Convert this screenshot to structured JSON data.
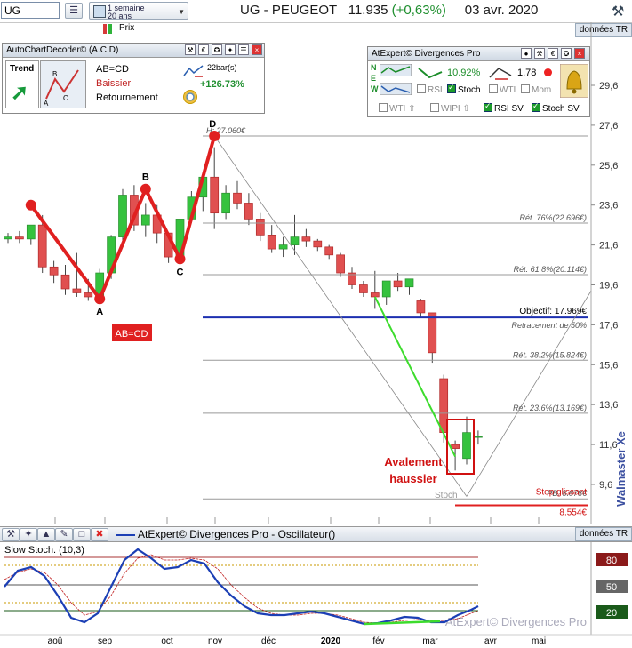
{
  "toolbar": {
    "ticker": "UG",
    "period_line1": "1 semaine",
    "period_line2": "20 ans",
    "price_label": "Prix",
    "title_symbol": "UG - PEUGEOT",
    "title_price": "11.935",
    "title_change": "(+0,63%)",
    "title_date": "03 avr. 2020",
    "data_button": "données TR"
  },
  "acd": {
    "header": "AutoChartDecoder© (A.C.D)",
    "trend_label": "Trend",
    "pattern": "AB=CD",
    "direction": "Baissier",
    "signal": "Retournement",
    "bars": "22bar(s)",
    "performance": "+126.73%"
  },
  "atexpert": {
    "header": "AtExpert© Divergences Pro",
    "pct": "10.92%",
    "ratio": "1.78",
    "rsi": "RSI",
    "stoch": "Stoch",
    "wti": "WTI",
    "mom": "Mom",
    "wti2": "WTI",
    "wipi": "WIPI",
    "rsi_sv": "RSI SV",
    "stoch_sv": "Stoch SV",
    "side_letters": [
      "N",
      "E",
      "W"
    ]
  },
  "oscillator": {
    "title": "AtExpert© Divergences Pro - Oscillateur()",
    "data_button": "données TR",
    "indicator": "Slow Stoch. (10,3)",
    "levels": [
      "80",
      "50",
      "20"
    ],
    "watermark": "AtExpert© Divergences Pro"
  },
  "side_text": "Walmaster Xe",
  "chart_data": {
    "type": "candlestick",
    "y_ticks": [
      29.6,
      27.6,
      25.6,
      23.6,
      21.6,
      19.6,
      17.6,
      15.6,
      13.6,
      11.6,
      9.6
    ],
    "y_range": [
      8.4,
      30.3
    ],
    "x_ticks": [
      "aoû",
      "sep",
      "oct",
      "nov",
      "déc",
      "2020",
      "fév",
      "mar",
      "avr",
      "mai"
    ],
    "candles": [
      {
        "o": 21.9,
        "h": 22.2,
        "l": 21.7,
        "c": 22.0
      },
      {
        "o": 22.0,
        "h": 22.3,
        "l": 21.7,
        "c": 21.9
      },
      {
        "o": 21.9,
        "h": 22.2,
        "l": 21.6,
        "c": 22.6
      },
      {
        "o": 22.6,
        "h": 23.1,
        "l": 20.2,
        "c": 20.5
      },
      {
        "o": 20.5,
        "h": 20.8,
        "l": 19.7,
        "c": 20.1
      },
      {
        "o": 20.1,
        "h": 20.6,
        "l": 19.1,
        "c": 19.4
      },
      {
        "o": 19.4,
        "h": 21.2,
        "l": 19.0,
        "c": 19.2
      },
      {
        "o": 19.2,
        "h": 19.9,
        "l": 18.8,
        "c": 19.0
      },
      {
        "o": 19.0,
        "h": 20.4,
        "l": 18.7,
        "c": 20.2
      },
      {
        "o": 20.2,
        "h": 22.1,
        "l": 19.9,
        "c": 22.0
      },
      {
        "o": 22.0,
        "h": 24.4,
        "l": 21.6,
        "c": 24.1
      },
      {
        "o": 24.1,
        "h": 24.6,
        "l": 22.3,
        "c": 22.6
      },
      {
        "o": 22.6,
        "h": 23.7,
        "l": 22.0,
        "c": 23.1
      },
      {
        "o": 23.1,
        "h": 23.6,
        "l": 21.7,
        "c": 22.2
      },
      {
        "o": 22.2,
        "h": 21.9,
        "l": 20.7,
        "c": 21.0
      },
      {
        "o": 21.0,
        "h": 23.3,
        "l": 20.9,
        "c": 22.9
      },
      {
        "o": 22.9,
        "h": 24.3,
        "l": 22.7,
        "c": 24.0
      },
      {
        "o": 24.0,
        "h": 25.0,
        "l": 23.3,
        "c": 25.0
      },
      {
        "o": 25.0,
        "h": 26.5,
        "l": 22.4,
        "c": 23.2
      },
      {
        "o": 23.2,
        "h": 24.6,
        "l": 22.9,
        "c": 24.2
      },
      {
        "o": 24.2,
        "h": 24.8,
        "l": 23.4,
        "c": 23.7
      },
      {
        "o": 23.7,
        "h": 24.2,
        "l": 22.6,
        "c": 22.9
      },
      {
        "o": 22.9,
        "h": 23.2,
        "l": 21.8,
        "c": 22.1
      },
      {
        "o": 22.1,
        "h": 22.6,
        "l": 21.2,
        "c": 21.4
      },
      {
        "o": 21.4,
        "h": 22.0,
        "l": 21.0,
        "c": 21.6
      },
      {
        "o": 21.6,
        "h": 23.1,
        "l": 21.1,
        "c": 22.0
      },
      {
        "o": 22.0,
        "h": 22.4,
        "l": 21.5,
        "c": 21.8
      },
      {
        "o": 21.8,
        "h": 21.9,
        "l": 21.3,
        "c": 21.5
      },
      {
        "o": 21.5,
        "h": 21.6,
        "l": 20.9,
        "c": 21.1
      },
      {
        "o": 21.1,
        "h": 21.2,
        "l": 20.0,
        "c": 20.2
      },
      {
        "o": 20.2,
        "h": 20.5,
        "l": 19.4,
        "c": 19.6
      },
      {
        "o": 19.6,
        "h": 19.8,
        "l": 19.0,
        "c": 19.2
      },
      {
        "o": 19.2,
        "h": 20.3,
        "l": 18.4,
        "c": 19.0
      },
      {
        "o": 19.0,
        "h": 19.8,
        "l": 18.6,
        "c": 19.8
      },
      {
        "o": 19.8,
        "h": 20.2,
        "l": 19.3,
        "c": 19.5
      },
      {
        "o": 19.5,
        "h": 19.9,
        "l": 19.1,
        "c": 19.9
      },
      {
        "o": 18.8,
        "h": 18.9,
        "l": 18.0,
        "c": 18.2
      },
      {
        "o": 18.2,
        "h": 18.2,
        "l": 15.7,
        "c": 16.2
      },
      {
        "o": 14.9,
        "h": 15.1,
        "l": 11.7,
        "c": 12.2
      },
      {
        "o": 11.6,
        "h": 11.8,
        "l": 10.3,
        "c": 11.4
      },
      {
        "o": 10.9,
        "h": 13.0,
        "l": 10.6,
        "c": 12.2
      },
      {
        "o": 12.0,
        "h": 12.3,
        "l": 11.6,
        "c": 12.0
      }
    ],
    "fib_levels": [
      {
        "label": "H: 27.060€",
        "value": 27.06
      },
      {
        "label": "Rét. 76%(22.696€)",
        "value": 22.696
      },
      {
        "label": "Rét. 61.8%(20.114€)",
        "value": 20.114
      },
      {
        "label": "Rét. 38.2%(15.824€)",
        "value": 15.824
      },
      {
        "label": "Rét. 23.6%(13.169€)",
        "value": 13.169
      },
      {
        "label": "PB: 8.878€",
        "value": 8.878
      }
    ],
    "objectif": {
      "label": "Objectif: 17.969€",
      "value": 17.969
    },
    "retracement_label": "Retracement de 50%",
    "stop": {
      "label": "Stop glissant",
      "value_label": "8.554€",
      "value": 8.554
    },
    "abcd_points": [
      {
        "label": "A",
        "idx": 8,
        "price": 18.9
      },
      {
        "label": "B",
        "idx": 12,
        "price": 24.4
      },
      {
        "label": "C",
        "idx": 15,
        "price": 20.9
      },
      {
        "label": "D",
        "idx": 18,
        "price": 27.06
      }
    ],
    "pattern_badge": "AB=CD",
    "annotation_line1": "Avalement",
    "annotation_line2": "haussier",
    "stoch_label": "Stoch"
  }
}
